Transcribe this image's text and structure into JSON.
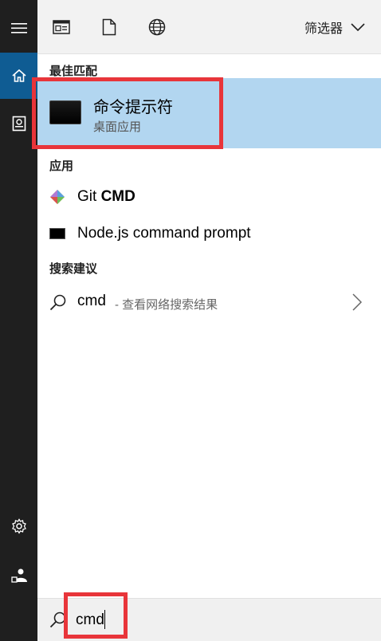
{
  "rail": {
    "items": [
      {
        "icon": "menu-icon"
      },
      {
        "icon": "home-icon",
        "active": true
      },
      {
        "icon": "document-icon"
      },
      {
        "icon": "settings-icon"
      },
      {
        "icon": "user-icon"
      }
    ]
  },
  "toolbar": {
    "icons": [
      "apps-icon",
      "document-icon",
      "web-icon"
    ],
    "filter_label": "筛选器"
  },
  "sections": {
    "best_match": "最佳匹配",
    "apps": "应用",
    "suggestions": "搜索建议"
  },
  "best_match": {
    "title": "命令提示符",
    "subtitle": "桌面应用"
  },
  "apps": [
    {
      "name_prefix": "Git ",
      "name_bold": "CMD",
      "icon": "git-icon"
    },
    {
      "name": "Node.js command prompt",
      "icon": "terminal-icon"
    }
  ],
  "suggestion": {
    "query": "cmd",
    "description": "- 查看网络搜索结果"
  },
  "search": {
    "value": "cmd"
  },
  "colors": {
    "rail_bg": "#1f1f1f",
    "rail_active": "#0f5c93",
    "selection": "#b2d6f0",
    "highlight": "#e8353a"
  }
}
